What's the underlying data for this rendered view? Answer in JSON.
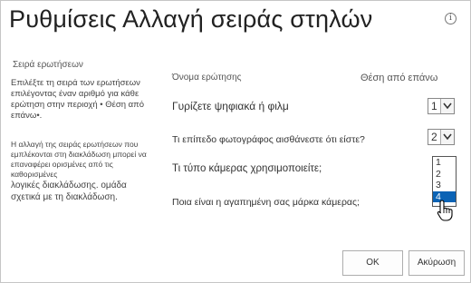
{
  "dialog": {
    "title": "Ρυθμίσεις  Αλλαγή σειράς στηλών",
    "info_icon": "i"
  },
  "sidebar": {
    "heading": "Σειρά ερωτήσεων",
    "text1": "Επιλέξτε τη σειρά των ερωτήσεων επιλέγοντας έναν αριθμό για κάθε ερώτηση στην περιοχή • Θέση από επάνω•.",
    "text2_small": "Η αλλαγή της σειράς ερωτήσεων που εμπλέκονται στη διακλάδωση μπορεί να επαναφέρει ορισμένες από τις καθορισμένες",
    "text2_big": "λογικές διακλάδωσης. ομάδα σχετικά με τη διακλάδωση."
  },
  "table": {
    "col_name": "Όνομα ερώτησης",
    "col_position": "Θέση από επάνω",
    "rows": [
      {
        "question": "Γυρίζετε ψηφιακά ή φιλμ",
        "position": "1"
      },
      {
        "question": "Τι επίπεδο φωτογράφος αισθάνεστε ότι είστε?",
        "position": "2"
      },
      {
        "question": "Τι τύπο κάμερας χρησιμοποιείτε;"
      },
      {
        "question": "Ποια είναι η αγαπημένη σας μάρκα κάμερας;"
      }
    ],
    "open_list": {
      "options": [
        "1",
        "2",
        "3",
        "4"
      ],
      "selected": "4"
    }
  },
  "buttons": {
    "ok": "OK",
    "cancel": "Ακύρωση"
  },
  "colors": {
    "selection": "#0b63b5"
  }
}
